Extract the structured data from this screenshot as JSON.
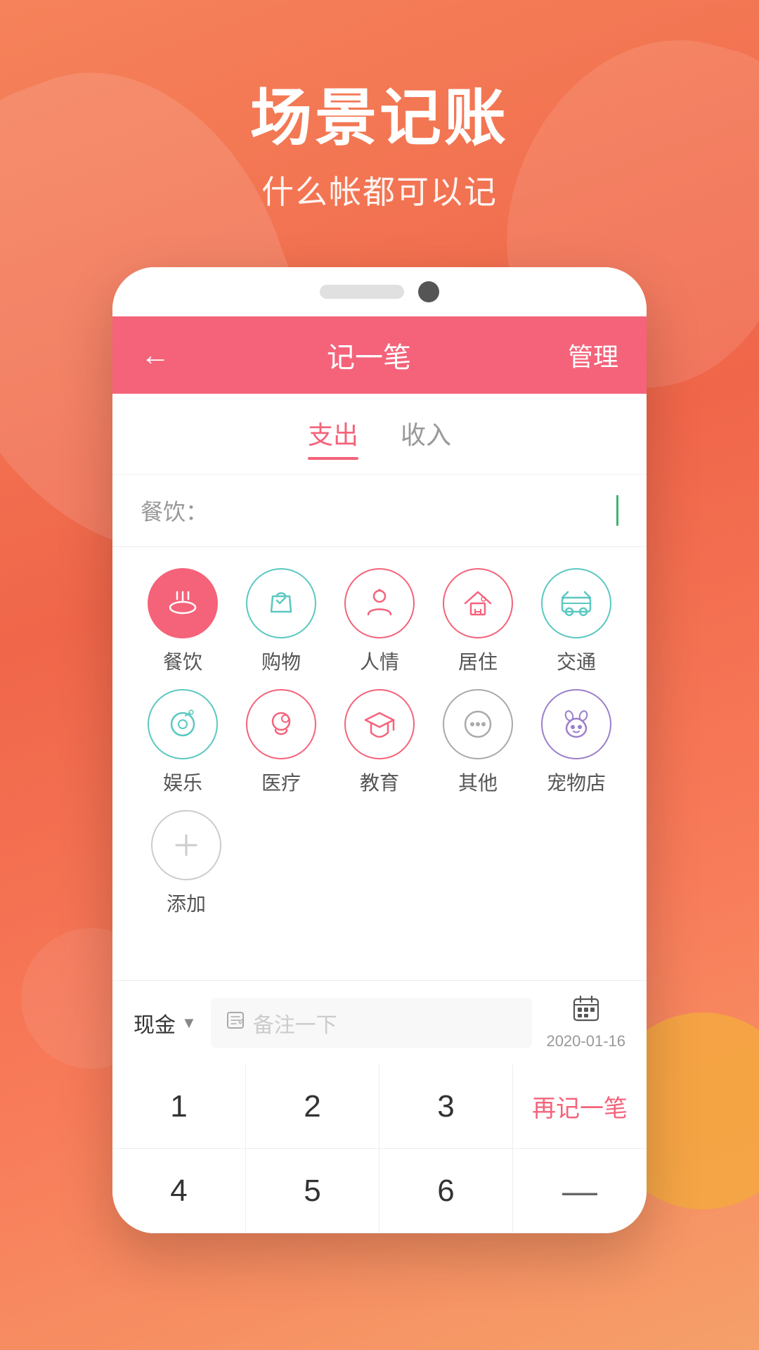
{
  "background": {
    "color_top": "#f5825a",
    "color_bottom": "#f87c5a"
  },
  "header": {
    "main_title": "场景记账",
    "sub_title": "什么帐都可以记"
  },
  "app_bar": {
    "back_label": "←",
    "title": "记一笔",
    "manage_label": "管理"
  },
  "tabs": [
    {
      "label": "支出",
      "active": true
    },
    {
      "label": "收入",
      "active": false
    }
  ],
  "input": {
    "label": "餐饮：",
    "value": "",
    "placeholder": ""
  },
  "categories": [
    {
      "label": "餐饮",
      "icon": "dining",
      "selected": true,
      "color": "coral"
    },
    {
      "label": "购物",
      "icon": "shopping",
      "selected": false,
      "color": "teal"
    },
    {
      "label": "人情",
      "icon": "social",
      "selected": false,
      "color": "coral"
    },
    {
      "label": "居住",
      "icon": "home",
      "selected": false,
      "color": "coral"
    },
    {
      "label": "交通",
      "icon": "transport",
      "selected": false,
      "color": "teal"
    },
    {
      "label": "娱乐",
      "icon": "entertainment",
      "selected": false,
      "color": "teal"
    },
    {
      "label": "医疗",
      "icon": "medical",
      "selected": false,
      "color": "coral"
    },
    {
      "label": "教育",
      "icon": "education",
      "selected": false,
      "color": "coral"
    },
    {
      "label": "其他",
      "icon": "other",
      "selected": false,
      "color": "gray"
    },
    {
      "label": "宠物店",
      "icon": "pet",
      "selected": false,
      "color": "purple"
    },
    {
      "label": "添加",
      "icon": "add",
      "selected": false,
      "color": "add"
    }
  ],
  "bottom": {
    "payment_method": "现金",
    "payment_arrow": "▼",
    "note_placeholder": "备注一下",
    "date": "2020-01-16",
    "calendar_icon": "📅"
  },
  "numpad": {
    "keys": [
      {
        "label": "1",
        "type": "number"
      },
      {
        "label": "2",
        "type": "number"
      },
      {
        "label": "3",
        "type": "number"
      },
      {
        "label": "再记一笔",
        "type": "action"
      },
      {
        "label": "4",
        "type": "number"
      },
      {
        "label": "5",
        "type": "number"
      },
      {
        "label": "6",
        "type": "number"
      },
      {
        "label": "—",
        "type": "dash"
      }
    ]
  }
}
